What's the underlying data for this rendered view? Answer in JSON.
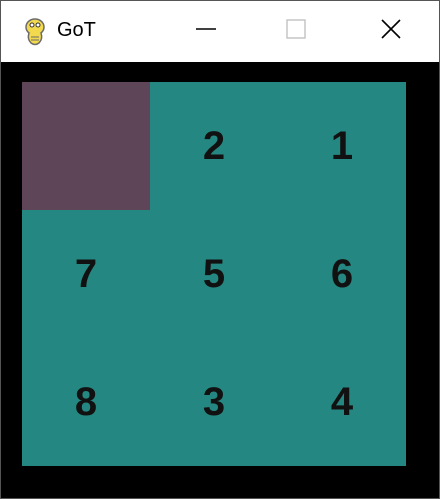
{
  "window": {
    "title": "GoT",
    "icon": "python-snake-icon",
    "controls": [
      "minimize-icon",
      "maximize-icon",
      "close-icon"
    ]
  },
  "game": {
    "board_color": "#258781",
    "empty_color": "#5e4658",
    "background_color": "#000000",
    "grid": [
      [
        "",
        "2",
        "1"
      ],
      [
        "7",
        "5",
        "6"
      ],
      [
        "8",
        "3",
        "4"
      ]
    ]
  }
}
